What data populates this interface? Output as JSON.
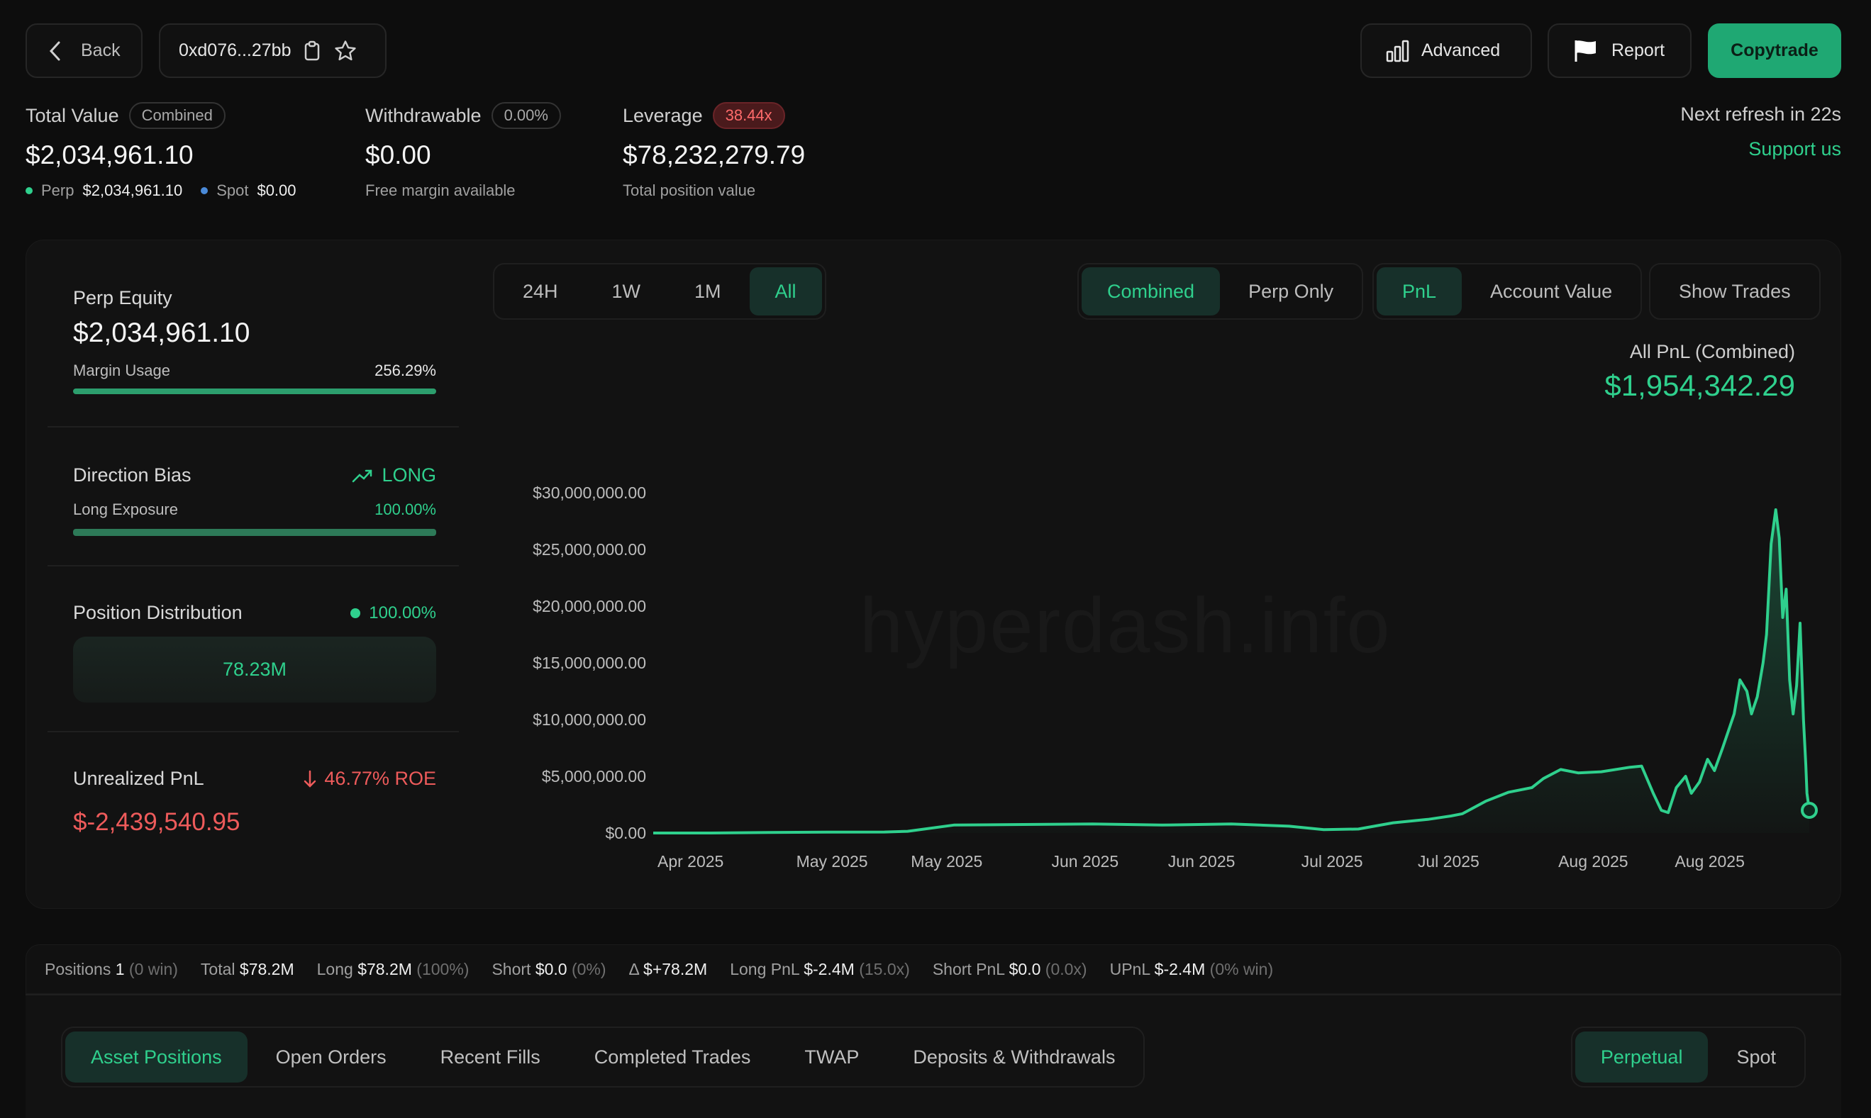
{
  "header": {
    "back_label": "Back",
    "address": "0xd076...27bb",
    "advanced_label": "Advanced",
    "report_label": "Report",
    "copytrade_label": "Copytrade"
  },
  "summary": {
    "total_value_label": "Total Value",
    "total_value_chip": "Combined",
    "total_value": "$2,034,961.10",
    "perp_label": "Perp",
    "perp_value": "$2,034,961.10",
    "spot_label": "Spot",
    "spot_value": "$0.00",
    "withdrawable_label": "Withdrawable",
    "withdrawable_chip": "0.00%",
    "withdrawable_value": "$0.00",
    "withdrawable_sub": "Free margin available",
    "leverage_label": "Leverage",
    "leverage_chip": "38.44x",
    "leverage_value": "$78,232,279.79",
    "leverage_sub": "Total position value",
    "next_refresh": "Next refresh in 22s",
    "support": "Support us"
  },
  "side": {
    "perp_equity_label": "Perp Equity",
    "perp_equity_value": "$2,034,961.10",
    "margin_usage_label": "Margin Usage",
    "margin_usage_value": "256.29%",
    "margin_usage_fill": 1.0,
    "direction_bias_label": "Direction Bias",
    "direction_bias_value": "LONG",
    "long_exposure_label": "Long Exposure",
    "long_exposure_value": "100.00%",
    "long_exposure_fill": 1.0,
    "position_distribution_label": "Position Distribution",
    "position_distribution_value": "100.00%",
    "position_box": "78.23M",
    "upnl_label": "Unrealized PnL",
    "upnl_roe": "46.77% ROE",
    "upnl_value": "$-2,439,540.95"
  },
  "range_tabs": [
    "24H",
    "1W",
    "1M",
    "All"
  ],
  "range_active": 3,
  "mode_tabs": [
    "Combined",
    "Perp Only"
  ],
  "mode_active": 0,
  "metric_tabs": [
    "PnL",
    "Account Value"
  ],
  "metric_active": 0,
  "show_trades_label": "Show Trades",
  "pnl_label": "All PnL (Combined)",
  "pnl_value": "$1,954,342.29",
  "watermark": "hyperdash.info",
  "chart_data": {
    "type": "area",
    "y_ticks": [
      "$30,000,000.00",
      "$25,000,000.00",
      "$20,000,000.00",
      "$15,000,000.00",
      "$10,000,000.00",
      "$5,000,000.00",
      "$0.00"
    ],
    "x_ticks": [
      "Apr 2025",
      "May 2025",
      "May 2025",
      "Jun 2025",
      "Jun 2025",
      "Jul 2025",
      "Jul 2025",
      "Aug 2025",
      "Aug 2025"
    ],
    "ylim": [
      0,
      30000000
    ],
    "series_color": "#2fd08d",
    "points": [
      [
        0,
        0
      ],
      [
        0.05,
        0
      ],
      [
        0.1,
        50000
      ],
      [
        0.15,
        80000
      ],
      [
        0.2,
        90000
      ],
      [
        0.22,
        150000
      ],
      [
        0.26,
        700000
      ],
      [
        0.32,
        750000
      ],
      [
        0.38,
        800000
      ],
      [
        0.44,
        700000
      ],
      [
        0.5,
        800000
      ],
      [
        0.55,
        600000
      ],
      [
        0.58,
        300000
      ],
      [
        0.61,
        350000
      ],
      [
        0.64,
        900000
      ],
      [
        0.67,
        1200000
      ],
      [
        0.69,
        1500000
      ],
      [
        0.7,
        1700000
      ],
      [
        0.72,
        2800000
      ],
      [
        0.74,
        3600000
      ],
      [
        0.76,
        4000000
      ],
      [
        0.77,
        4800000
      ],
      [
        0.785,
        5600000
      ],
      [
        0.8,
        5300000
      ],
      [
        0.82,
        5400000
      ],
      [
        0.845,
        5800000
      ],
      [
        0.855,
        5900000
      ],
      [
        0.865,
        3500000
      ],
      [
        0.872,
        2000000
      ],
      [
        0.878,
        1800000
      ],
      [
        0.885,
        4000000
      ],
      [
        0.893,
        5000000
      ],
      [
        0.898,
        3500000
      ],
      [
        0.905,
        4500000
      ],
      [
        0.912,
        6500000
      ],
      [
        0.918,
        5500000
      ],
      [
        0.925,
        7500000
      ],
      [
        0.935,
        10500000
      ],
      [
        0.94,
        13500000
      ],
      [
        0.946,
        12500000
      ],
      [
        0.95,
        10500000
      ],
      [
        0.955,
        12000000
      ],
      [
        0.96,
        15000000
      ],
      [
        0.963,
        17500000
      ],
      [
        0.967,
        25500000
      ],
      [
        0.971,
        28500000
      ],
      [
        0.974,
        26000000
      ],
      [
        0.977,
        19000000
      ],
      [
        0.98,
        21500000
      ],
      [
        0.983,
        13500000
      ],
      [
        0.986,
        10500000
      ],
      [
        0.989,
        13000000
      ],
      [
        0.992,
        18500000
      ],
      [
        0.995,
        10000000
      ],
      [
        0.997,
        6000000
      ],
      [
        0.998,
        3500000
      ],
      [
        1.0,
        2000000
      ]
    ]
  },
  "stats": {
    "positions_label": "Positions",
    "positions_value": "1",
    "positions_note": "(0 win)",
    "total_label": "Total",
    "total_value": "$78.2M",
    "long_label": "Long",
    "long_value": "$78.2M",
    "long_note": "(100%)",
    "short_label": "Short",
    "short_value": "$0.0",
    "short_note": "(0%)",
    "delta_label": "Δ",
    "delta_value": "$+78.2M",
    "long_pnl_label": "Long PnL",
    "long_pnl_value": "$-2.4M",
    "long_pnl_note": "(15.0x)",
    "short_pnl_label": "Short PnL",
    "short_pnl_value": "$0.0",
    "short_pnl_note": "(0.0x)",
    "upnl_label": "UPnL",
    "upnl_value": "$-2.4M",
    "upnl_note": "(0% win)"
  },
  "bottom_tabs": [
    "Asset Positions",
    "Open Orders",
    "Recent Fills",
    "Completed Trades",
    "TWAP",
    "Deposits & Withdrawals"
  ],
  "bottom_active": 0,
  "market_tabs": [
    "Perpetual",
    "Spot"
  ],
  "market_active": 0
}
